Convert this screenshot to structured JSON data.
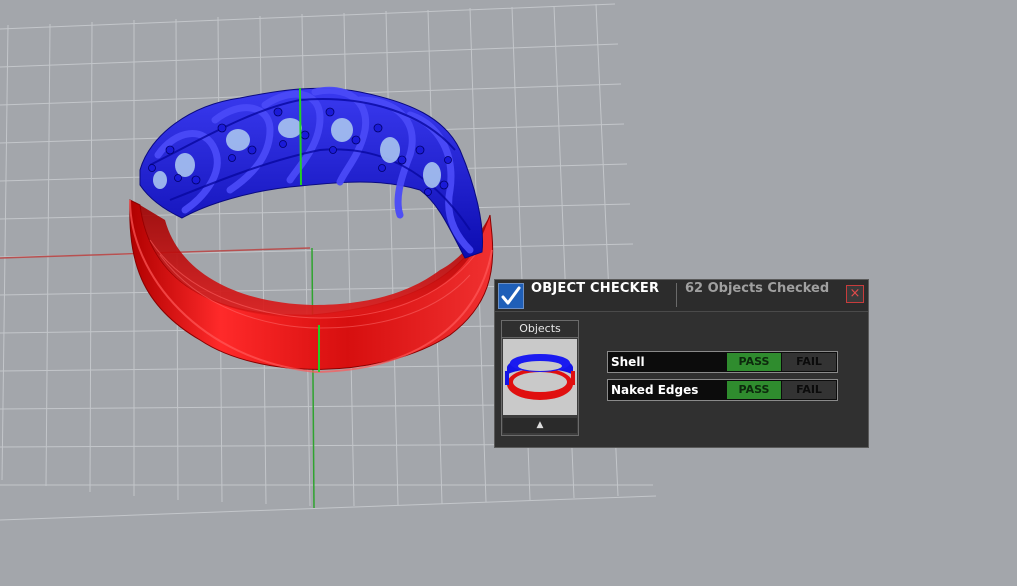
{
  "checker": {
    "title": "OBJECT CHECKER",
    "count_text": "62  Objects Checked",
    "close_symbol": "×",
    "objects_label": "Objects",
    "scroll_symbol": "▲",
    "checks": [
      {
        "label": "Shell",
        "pass": "PASS",
        "fail": "FAIL",
        "result": "pass"
      },
      {
        "label": "Naked Edges",
        "pass": "PASS",
        "fail": "FAIL",
        "result": "pass"
      }
    ]
  },
  "colors": {
    "background": "#a3a6ab",
    "grid": "#c9ccd0",
    "ring_band": "#d80f0f",
    "ring_top": "#1212c6",
    "pass_green": "#2f8c2e",
    "x_axis": "#b85050",
    "y_axis": "#2fa42f"
  },
  "icons": {
    "logo": "check-icon",
    "close": "close-icon",
    "scroll": "up-arrow-icon"
  }
}
